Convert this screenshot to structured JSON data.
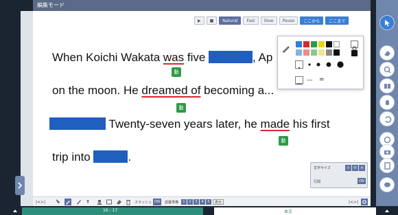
{
  "header": {
    "mode_label": "編集モード"
  },
  "playbar": {
    "play_label": "▶",
    "stop_label": "■",
    "speeds": [
      "Natural",
      "Fast",
      "Slow",
      "Pause"
    ],
    "selected_speed": "Natural",
    "from_here_label": "ここから",
    "until_here_label": "ここまで"
  },
  "passage": {
    "line1_before": "When Koichi Wakata ",
    "line1_verb": "was",
    "line1_middle": " five",
    "line1_after": ", Ap",
    "line2_before": "on the moon.   He ",
    "line2_verb": "dreamed of",
    "line2_after": " becoming a...",
    "line3_before": " Twenty-seven years later, he ",
    "line3_verb": "made",
    "line3_after": " his first",
    "line4_before": "trip into",
    "line4_after": ".",
    "verb_tag": "動"
  },
  "palette": {
    "colors_row1": [
      "#2c7fd9",
      "#d8282f",
      "#2e9a48",
      "#e9d21e",
      "#111111",
      "#ffffff"
    ],
    "colors_row2": [
      "#7fb3ea",
      "#ef8a8a",
      "#86c98f",
      "#f2e68a",
      "#888888",
      "#111111"
    ],
    "dash_label": "---",
    "double_label": "="
  },
  "popup": {
    "font_size_label": "文字サイズ",
    "line_label": "行間",
    "toggle_label": "ON"
  },
  "toolbar": {
    "nav_label": "|<>|",
    "slash_label": "スラッシュ",
    "slash_state": "ON",
    "hide_label": "語彙準備",
    "numbers": [
      "1",
      "2",
      "3",
      "4",
      "5"
    ],
    "display_label": "表示",
    "page_nav_label": "|<>|"
  },
  "status": {
    "page_range": "16 - 17",
    "right_label": "本文"
  },
  "colors": {
    "accent": "#5c6fa0",
    "sidebar": "#6f87ad",
    "blank": "#1f5fbf",
    "underline": "#d8282f",
    "verb_tag": "#2e9a48"
  }
}
